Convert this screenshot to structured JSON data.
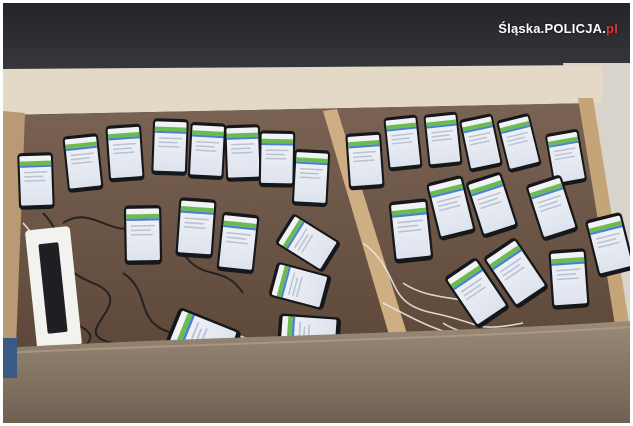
{
  "watermark": {
    "text": "Śląska.POLICJA.pl",
    "accent_color": "#e0363a"
  },
  "scene": {
    "description_colors": {
      "wall": "#2b2c30",
      "drawer_wood": "#c9a77a",
      "drawer_floor": "#6b5544",
      "couch_fabric": "#8d7b69",
      "screen_green": "#6cbb4e",
      "screen_blue": "#4a7fd4"
    }
  }
}
